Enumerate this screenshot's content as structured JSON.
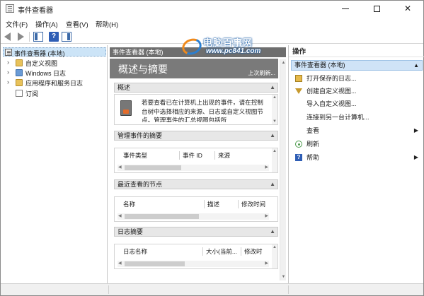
{
  "window": {
    "title": "事件查看器"
  },
  "menubar": {
    "items": [
      "文件(F)",
      "操作(A)",
      "查看(V)",
      "帮助(H)"
    ]
  },
  "tree": {
    "root": "事件查看器 (本地)",
    "children": [
      "自定义视图",
      "Windows 日志",
      "应用程序和服务日志",
      "订阅"
    ]
  },
  "center": {
    "header": "事件查看器 (本地)",
    "banner_title": "概述与摘要",
    "refresh_text": "上次刷新..."
  },
  "overview": {
    "title": "概述",
    "text": "若要查看已在计算机上出现的事件，请在控制台树中选择相应的来源、日志或自定义视图节点。管理事件的汇总视图包括所"
  },
  "admin_summary": {
    "title": "管理事件的摘要",
    "columns": [
      "事件类型",
      "事件 ID",
      "来源"
    ]
  },
  "recent_nodes": {
    "title": "最近查看的节点",
    "columns": [
      "名称",
      "描述",
      "修改时间"
    ]
  },
  "log_summary": {
    "title": "日志摘要",
    "columns": [
      "日志名称",
      "大小(当前...",
      "修改时"
    ]
  },
  "actions": {
    "header": "操作",
    "section": "事件查看器 (本地)",
    "items": [
      "打开保存的日志...",
      "创建自定义视图...",
      "导入自定义视图...",
      "连接到另一台计算机...",
      "查看",
      "刷新",
      "帮助"
    ]
  },
  "watermark": {
    "name": "电脑百事网",
    "url": "www.pc841.com"
  },
  "colors": {
    "selection": "#cce4f7",
    "header_gray": "#6e6e6e",
    "help_blue": "#2f5eb5",
    "watermark_orange": "#f08a1c",
    "watermark_blue": "#2a7fd1"
  }
}
